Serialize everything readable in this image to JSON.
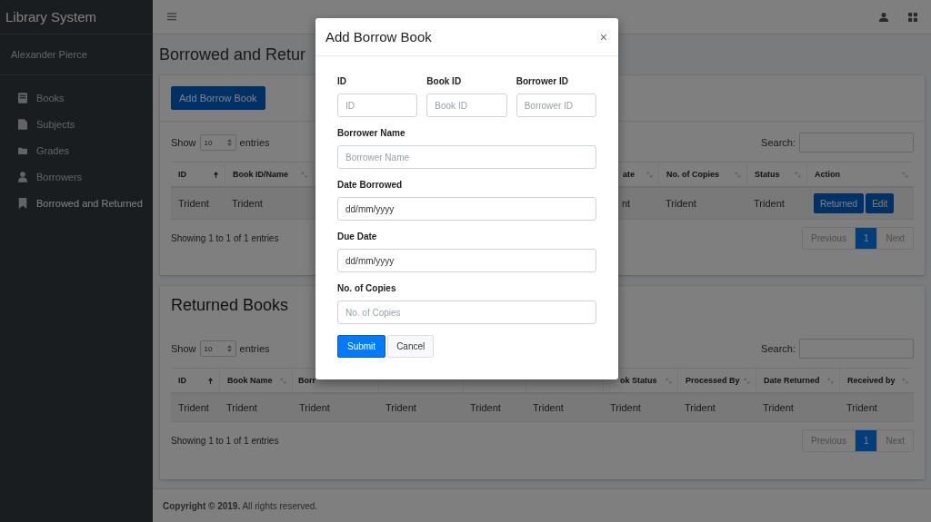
{
  "sidebar": {
    "brand": "Library System",
    "user": "Alexander Pierce",
    "items": [
      {
        "label": "Books",
        "selected": false
      },
      {
        "label": "Subjects",
        "selected": false
      },
      {
        "label": "Grades",
        "selected": false
      },
      {
        "label": "Borrowers",
        "selected": false
      },
      {
        "label": "Borrowed and Returned",
        "selected": true
      }
    ]
  },
  "page_title": "Borrowed and Retur",
  "borrowed_card": {
    "add_button": "Add Borrow Book",
    "show": "Show",
    "page_size": "10",
    "entries": "entries",
    "search_label": "Search:",
    "columns": [
      {
        "label": "ID",
        "sorted": true
      },
      {
        "label": "Book ID/Name",
        "sorted": false
      },
      {
        "label": "ate",
        "sorted": false
      },
      {
        "label": "No. of Copies",
        "sorted": false
      },
      {
        "label": "Status",
        "sorted": false
      },
      {
        "label": "Action",
        "sorted": false
      }
    ],
    "rows": [
      {
        "cells": [
          "Trident",
          "Trident",
          "nt",
          "Trident",
          "Trident"
        ],
        "actions": [
          "Returned",
          "Edit"
        ]
      }
    ],
    "info": "Showing 1 to 1 of 1 entries",
    "pages": [
      {
        "label": "Previous",
        "selected": false
      },
      {
        "label": "1",
        "selected": true
      },
      {
        "label": "Next",
        "selected": false
      }
    ]
  },
  "returned_card": {
    "title": "Returned Books",
    "show": "Show",
    "page_size": "10",
    "entries": "entries",
    "search_label": "Search:",
    "columns": [
      {
        "label": "ID",
        "sorted": true
      },
      {
        "label": "Book Name",
        "sorted": false
      },
      {
        "label": "Borr"
      },
      {},
      {},
      {},
      {
        "label": "ok Status",
        "sorted": false
      },
      {
        "label": "Processed By",
        "sorted": false
      },
      {
        "label": "Date Returned",
        "sorted": false
      },
      {
        "label": "Received by",
        "sorted": false
      }
    ],
    "rows": [
      {
        "cells": [
          "Trident",
          "Trident",
          "Trident",
          "Trident",
          "Trident",
          "Trident",
          "Trident",
          "Trident",
          "Trident",
          "Trident"
        ]
      }
    ],
    "info": "Showing 1 to 1 of 1 entries",
    "pages": [
      {
        "label": "Previous",
        "selected": false
      },
      {
        "label": "1",
        "selected": true
      },
      {
        "label": "Next",
        "selected": false
      }
    ]
  },
  "footer": "**Copyright © 2019.** All rights reserved.",
  "modal": {
    "title": "Add Borrow Book",
    "close": "×",
    "fields": [
      {
        "label": "ID",
        "placeholder": "ID",
        "kind": "text"
      },
      {
        "label": "Book ID",
        "placeholder": "Book ID",
        "kind": "text"
      },
      {
        "label": "Borrower ID",
        "placeholder": "Borrower ID",
        "kind": "text"
      },
      {
        "label": "Borrower Name",
        "placeholder": "Borrower Name",
        "kind": "text"
      },
      {
        "label": "Date Borrowed",
        "placeholder": "dd/mm/yyyy",
        "kind": "date"
      },
      {
        "label": "Due Date",
        "placeholder": "dd/mm/yyyy",
        "kind": "date"
      },
      {
        "label": "No. of Copies",
        "placeholder": "No. of Copies",
        "kind": "text"
      }
    ],
    "submit": "Submit",
    "cancel": "Cancel"
  }
}
